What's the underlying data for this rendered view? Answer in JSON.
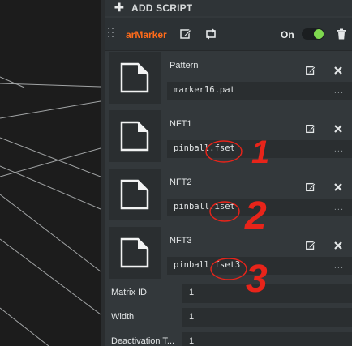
{
  "toolbar": {
    "add_script_label": "ADD SCRIPT"
  },
  "script": {
    "name": "arMarker",
    "enabled_label": "On",
    "enabled": true,
    "accent_color": "#ff6b1a",
    "toggle_color": "#7fd84f"
  },
  "assets": [
    {
      "label": "Pattern",
      "value": "marker16.pat",
      "more": "..."
    },
    {
      "label": "NFT1",
      "value": "pinball.fset",
      "more": "..."
    },
    {
      "label": "NFT2",
      "value": "pinball.iset",
      "more": "..."
    },
    {
      "label": "NFT3",
      "value": "pinball.fset3",
      "more": "..."
    }
  ],
  "fields": [
    {
      "label": "Matrix ID",
      "value": "1"
    },
    {
      "label": "Width",
      "value": "1"
    },
    {
      "label": "Deactivation T...",
      "value": "1"
    }
  ],
  "annotations": {
    "color": "#e8241a",
    "numbers": [
      "1",
      "2",
      "3"
    ]
  }
}
